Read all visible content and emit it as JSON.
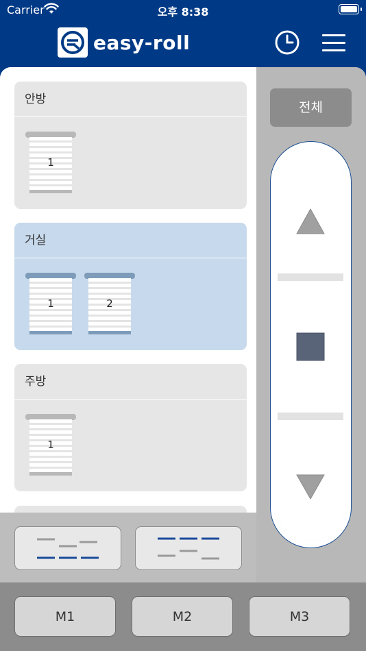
{
  "status_bar": {
    "carrier": "Carrier",
    "time": "오후 8:38"
  },
  "header": {
    "logo_text": "easy-roll"
  },
  "rooms": [
    {
      "name": "안방",
      "blinds": [
        "1"
      ],
      "selected": false
    },
    {
      "name": "거실",
      "blinds": [
        "1",
        "2"
      ],
      "selected": true
    },
    {
      "name": "주방",
      "blinds": [
        "1"
      ],
      "selected": false
    }
  ],
  "control": {
    "all_label": "전체"
  },
  "memory_buttons": [
    "M1",
    "M2",
    "M3"
  ],
  "colors": {
    "brand": "#003a86",
    "selected_room": "#c7d9ec",
    "group_blue": "#1a4a9a",
    "stop": "#5a6478",
    "arrow": "#a0a0a0"
  }
}
